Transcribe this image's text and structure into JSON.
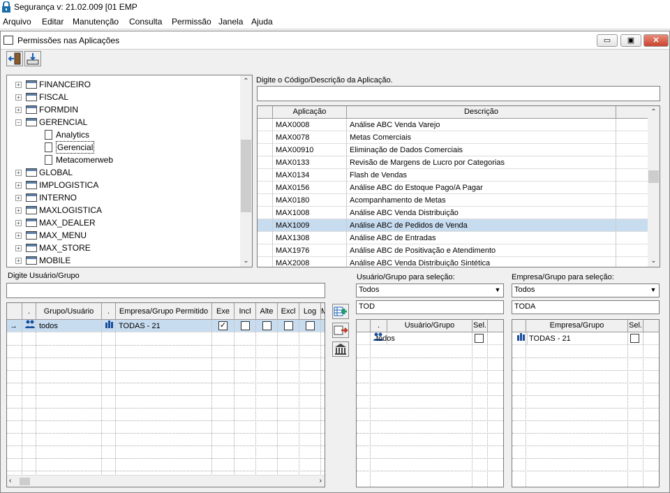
{
  "app": {
    "title": "Segurança  v: 21.02.009  [01 EMP"
  },
  "menu": [
    "Arquivo",
    "Editar",
    "Manutenção",
    "Consulta",
    "Permissão",
    "Janela",
    "Ajuda"
  ],
  "window": {
    "title": "Permissões nas Aplicações",
    "minimize": "▭",
    "restore": "▣",
    "close": "✕"
  },
  "toolbar": {
    "exit_icon": "exit-door-icon",
    "save_icon": "import-icon"
  },
  "tree": {
    "items": [
      {
        "label": "FINANCEIRO",
        "type": "folder",
        "expanded": false
      },
      {
        "label": "FISCAL",
        "type": "folder",
        "expanded": false
      },
      {
        "label": "FORMDIN",
        "type": "folder",
        "expanded": false
      },
      {
        "label": "GERENCIAL",
        "type": "folder",
        "expanded": true
      },
      {
        "label": "Analytics",
        "type": "doc"
      },
      {
        "label": "Gerencial",
        "type": "doc",
        "selected": true
      },
      {
        "label": "Metacomerweb",
        "type": "doc"
      },
      {
        "label": "GLOBAL",
        "type": "folder",
        "expanded": false
      },
      {
        "label": "IMPLOGISTICA",
        "type": "folder",
        "expanded": false
      },
      {
        "label": "INTERNO",
        "type": "folder",
        "expanded": false
      },
      {
        "label": "MAXLOGISTICA",
        "type": "folder",
        "expanded": false
      },
      {
        "label": "MAX_DEALER",
        "type": "folder",
        "expanded": false
      },
      {
        "label": "MAX_MENU",
        "type": "folder",
        "expanded": false
      },
      {
        "label": "MAX_STORE",
        "type": "folder",
        "expanded": false
      },
      {
        "label": "MOBILE",
        "type": "folder",
        "expanded": false
      }
    ]
  },
  "app_search": {
    "label": "Digite o Código/Descrição da Aplicação.",
    "value": ""
  },
  "apps_grid": {
    "headers": [
      "Aplicação",
      "Descrição"
    ],
    "rows": [
      [
        "MAX0008",
        "Análise ABC Venda Varejo"
      ],
      [
        "MAX0078",
        "Metas Comerciais"
      ],
      [
        "MAX00910",
        "Eliminação de Dados Comerciais"
      ],
      [
        "MAX0133",
        "Revisão de Margens de Lucro por Categorias"
      ],
      [
        "MAX0134",
        "Flash de Vendas"
      ],
      [
        "MAX0156",
        "Análise ABC do Estoque Pago/A Pagar"
      ],
      [
        "MAX0180",
        "Acompanhamento de Metas"
      ],
      [
        "MAX1008",
        "Análise ABC Venda Distribuição"
      ],
      [
        "MAX1009",
        "Análise ABC de Pedidos de Venda"
      ],
      [
        "MAX1308",
        "Análise ABC de Entradas"
      ],
      [
        "MAX1976",
        "Análise ABC de Positivação e Atendimento"
      ],
      [
        "MAX2008",
        "Análise ABC Venda Distribuição Sintética"
      ]
    ],
    "selected_row": 8
  },
  "user_search": {
    "label": "Digite Usuário/Grupo",
    "value": ""
  },
  "perm_grid": {
    "headers": [
      ".",
      "Grupo/Usuário",
      ".",
      "Empresa/Grupo Permitido",
      "Exe",
      "Incl",
      "Alte",
      "Excl",
      "Log",
      "M"
    ],
    "row": {
      "group": "todos",
      "company": "TODAS - 21",
      "exe": true,
      "incl": false,
      "alte": false,
      "excl": false,
      "log": false
    }
  },
  "user_select": {
    "label": "Usuário/Grupo para seleção:",
    "option": "Todos",
    "filter": "TOD",
    "headers": [
      ".",
      "Usuário/Grupo",
      "Sel."
    ],
    "row": {
      "name": "todos",
      "sel": false
    }
  },
  "company_select": {
    "label": "Empresa/Grupo para seleção:",
    "option": "Todos",
    "filter": "TODA",
    "headers": [
      ".",
      "Empresa/Grupo",
      "Sel."
    ],
    "row": {
      "name": "TODAS - 21",
      "sel": false
    }
  },
  "colors": {
    "selection": "#c8dcf0",
    "accent": "#1a5fb4"
  }
}
